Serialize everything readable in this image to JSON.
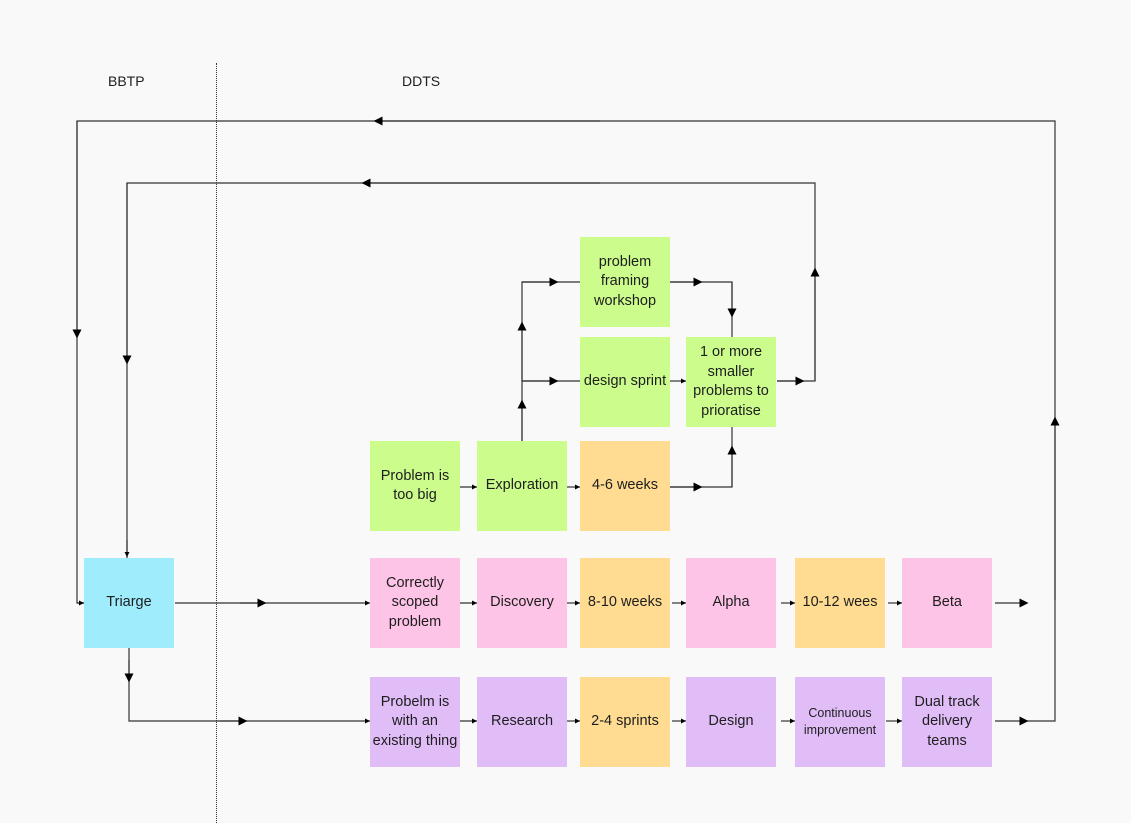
{
  "lanes": {
    "left": "BBTP",
    "right": "DDTS"
  },
  "colors": {
    "green": "#cbfc8c",
    "orange": "#ffdc92",
    "pink": "#fec4e7",
    "purple": "#e1bdf8",
    "cyan": "#9fecfc",
    "line": "#333333"
  },
  "nodes": {
    "triage": "Triarge",
    "too_big": "Problem is too big",
    "exploration": "Exploration",
    "weeks_4_6": "4-6 weeks",
    "framing": "problem framing workshop",
    "sprint": "design sprint",
    "smaller": "1 or more smaller problems to prioratise",
    "scoped": "Correctly scoped problem",
    "discovery": "Discovery",
    "weeks_8_10": "8-10 weeks",
    "alpha": "Alpha",
    "wees_10_12": "10-12 wees",
    "beta": "Beta",
    "existing": "Probelm is with an existing thing",
    "research": "Research",
    "sprints_2_4": "2-4 sprints",
    "design": "Design",
    "continuous": "Continuous improvement",
    "dual_track": "Dual track delivery teams"
  }
}
